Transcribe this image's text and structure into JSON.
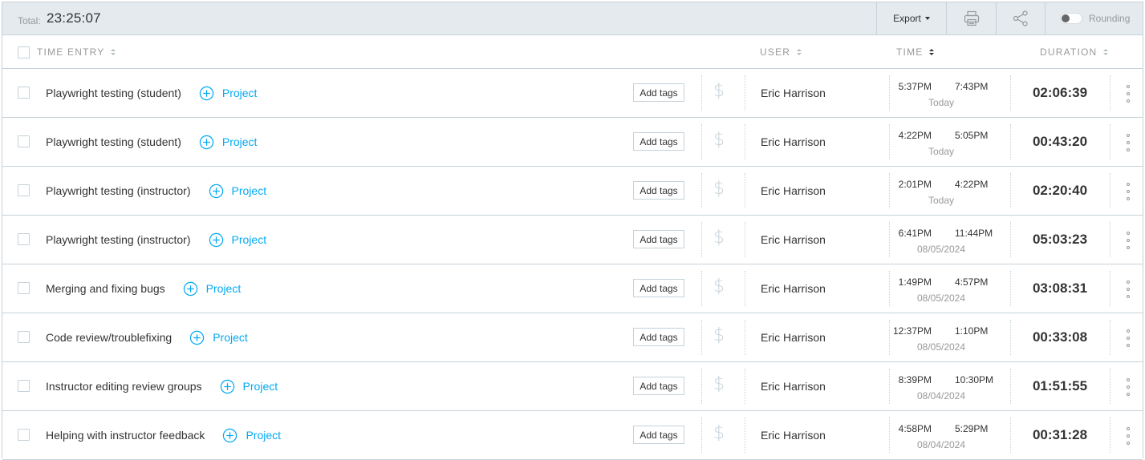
{
  "summary": {
    "total_label": "Total:",
    "total_value": "23:25:07"
  },
  "toolbar": {
    "export_label": "Export",
    "print_icon": "printer-icon",
    "share_icon": "share-icon",
    "rounding_label": "Rounding",
    "rounding_enabled": false
  },
  "columns": {
    "time_entry": "TIME ENTRY",
    "user": "USER",
    "time": "TIME",
    "duration": "DURATION"
  },
  "colors": {
    "accent": "#03a9f4",
    "border": "#c6d2d9",
    "topbar_bg": "#e4eaee",
    "muted_text": "#999999"
  },
  "entries": [
    {
      "description": "Playwright testing (student)",
      "project": "Project",
      "tags": "Add tags",
      "user": "Eric Harrison",
      "start": "5:37PM",
      "end": "7:43PM",
      "date": "Today",
      "duration": "02:06:39"
    },
    {
      "description": "Playwright testing (student)",
      "project": "Project",
      "tags": "Add tags",
      "user": "Eric Harrison",
      "start": "4:22PM",
      "end": "5:05PM",
      "date": "Today",
      "duration": "00:43:20"
    },
    {
      "description": "Playwright testing (instructor)",
      "project": "Project",
      "tags": "Add tags",
      "user": "Eric Harrison",
      "start": "2:01PM",
      "end": "4:22PM",
      "date": "Today",
      "duration": "02:20:40"
    },
    {
      "description": "Playwright testing (instructor)",
      "project": "Project",
      "tags": "Add tags",
      "user": "Eric Harrison",
      "start": "6:41PM",
      "end": "11:44PM",
      "date": "08/05/2024",
      "duration": "05:03:23"
    },
    {
      "description": "Merging and fixing bugs",
      "project": "Project",
      "tags": "Add tags",
      "user": "Eric Harrison",
      "start": "1:49PM",
      "end": "4:57PM",
      "date": "08/05/2024",
      "duration": "03:08:31"
    },
    {
      "description": "Code review/troublefixing",
      "project": "Project",
      "tags": "Add tags",
      "user": "Eric Harrison",
      "start": "12:37PM",
      "end": "1:10PM",
      "date": "08/05/2024",
      "duration": "00:33:08"
    },
    {
      "description": "Instructor editing review groups",
      "project": "Project",
      "tags": "Add tags",
      "user": "Eric Harrison",
      "start": "8:39PM",
      "end": "10:30PM",
      "date": "08/04/2024",
      "duration": "01:51:55"
    },
    {
      "description": "Helping with instructor feedback",
      "project": "Project",
      "tags": "Add tags",
      "user": "Eric Harrison",
      "start": "4:58PM",
      "end": "5:29PM",
      "date": "08/04/2024",
      "duration": "00:31:28"
    }
  ]
}
